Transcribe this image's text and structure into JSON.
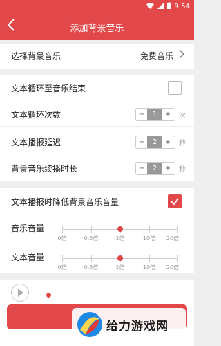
{
  "status": {
    "time": "9:54"
  },
  "header": {
    "title": "添加背景音乐"
  },
  "select_music": {
    "label": "选择背景音乐",
    "value": "免费音乐"
  },
  "loop_to_end": {
    "label": "文本循环至音乐结束",
    "checked": false
  },
  "loop_count": {
    "label": "文本循环次数",
    "minus": "−",
    "value": "1",
    "plus": "+",
    "unit": "次"
  },
  "play_delay": {
    "label": "文本播报延迟",
    "minus": "−",
    "value": "2",
    "plus": "+",
    "unit": "秒"
  },
  "continue_time": {
    "label": "背景音乐续播时长",
    "minus": "−",
    "value": "2",
    "plus": "+",
    "unit": "秒"
  },
  "lower_volume": {
    "label": "文本播报时降低背景音乐音量",
    "checked": true
  },
  "music_volume": {
    "label": "音乐音量",
    "ticks": [
      "0倍",
      "0.5倍",
      "1倍",
      "10倍",
      "20倍"
    ],
    "selected": "1倍"
  },
  "text_volume": {
    "label": "文本音量",
    "ticks": [
      "0倍",
      "0.5倍",
      "1倍",
      "10倍",
      "20倍"
    ],
    "selected": "1倍"
  },
  "watermark": {
    "text": "给力游戏网"
  },
  "colors": {
    "accent": "#e2474a"
  }
}
